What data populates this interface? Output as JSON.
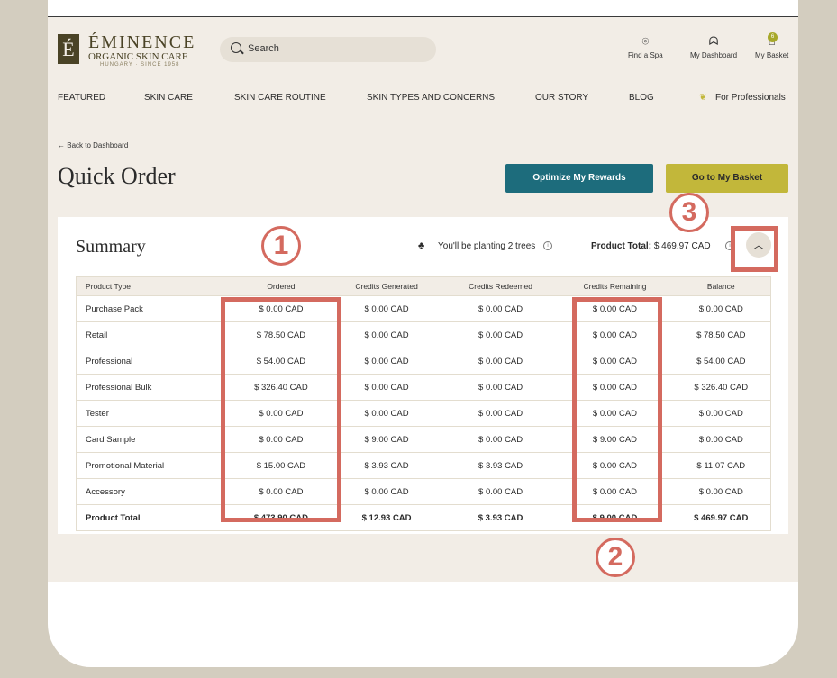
{
  "header": {
    "logo_letter": "É",
    "brand_name": "ÉMINENCE",
    "brand_sub": "ORGANIC SKIN CARE",
    "brand_tag": "HUNGARY · SINCE 1958",
    "search_placeholder": "Search",
    "find_spa": "Find a Spa",
    "dashboard": "My Dashboard",
    "basket": "My Basket",
    "basket_count": "6"
  },
  "nav": {
    "items": [
      "FEATURED",
      "SKIN CARE",
      "SKIN CARE ROUTINE",
      "SKIN TYPES AND CONCERNS",
      "OUR STORY",
      "BLOG",
      "For Professionals"
    ]
  },
  "page": {
    "back": "Back to Dashboard",
    "title": "Quick Order",
    "optimize_btn": "Optimize My Rewards",
    "basket_btn": "Go to My Basket"
  },
  "summary": {
    "title": "Summary",
    "trees_text": "You'll be planting 2 trees",
    "product_total_label": "Product Total:",
    "product_total_value": "$ 469.97 CAD",
    "columns": [
      "Product Type",
      "Ordered",
      "Credits Generated",
      "Credits Redeemed",
      "Credits Remaining",
      "Balance"
    ],
    "rows": [
      [
        "Purchase Pack",
        "$ 0.00 CAD",
        "$ 0.00 CAD",
        "$ 0.00 CAD",
        "$ 0.00 CAD",
        "$ 0.00 CAD"
      ],
      [
        "Retail",
        "$ 78.50 CAD",
        "$ 0.00 CAD",
        "$ 0.00 CAD",
        "$ 0.00 CAD",
        "$ 78.50 CAD"
      ],
      [
        "Professional",
        "$ 54.00 CAD",
        "$ 0.00 CAD",
        "$ 0.00 CAD",
        "$ 0.00 CAD",
        "$ 54.00 CAD"
      ],
      [
        "Professional Bulk",
        "$ 326.40 CAD",
        "$ 0.00 CAD",
        "$ 0.00 CAD",
        "$ 0.00 CAD",
        "$ 326.40 CAD"
      ],
      [
        "Tester",
        "$ 0.00 CAD",
        "$ 0.00 CAD",
        "$ 0.00 CAD",
        "$ 0.00 CAD",
        "$ 0.00 CAD"
      ],
      [
        "Card Sample",
        "$ 0.00 CAD",
        "$ 9.00 CAD",
        "$ 0.00 CAD",
        "$ 9.00 CAD",
        "$ 0.00 CAD"
      ],
      [
        "Promotional Material",
        "$ 15.00 CAD",
        "$ 3.93 CAD",
        "$ 3.93 CAD",
        "$ 0.00 CAD",
        "$ 11.07 CAD"
      ],
      [
        "Accessory",
        "$ 0.00 CAD",
        "$ 0.00 CAD",
        "$ 0.00 CAD",
        "$ 0.00 CAD",
        "$ 0.00 CAD"
      ],
      [
        "Product Total",
        "$ 473.90 CAD",
        "$ 12.93 CAD",
        "$ 3.93 CAD",
        "$ 9.00 CAD",
        "$ 469.97 CAD"
      ]
    ]
  },
  "annotations": {
    "one": "1",
    "two": "2",
    "three": "3"
  },
  "colors": {
    "accent_teal": "#1d6c7c",
    "accent_olive": "#c2b73a",
    "highlight": "#d46a5f"
  }
}
